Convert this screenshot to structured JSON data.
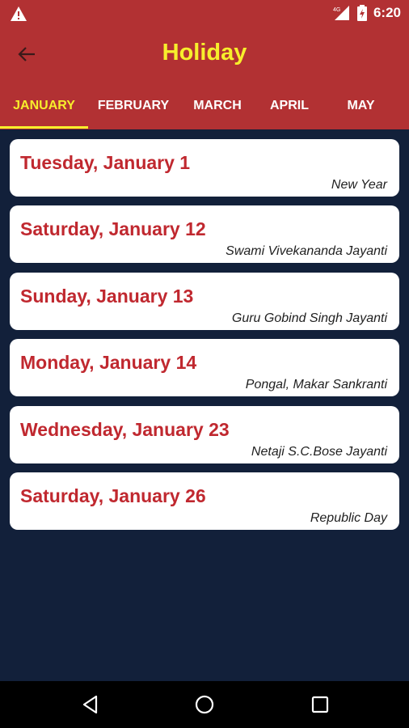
{
  "status_bar": {
    "network": "4G",
    "battery_icon": "battery-charging-icon",
    "time": "6:20"
  },
  "app_bar": {
    "title": "Holiday",
    "back_icon": "back-arrow-icon"
  },
  "tabs": [
    {
      "label": "JANUARY",
      "active": true
    },
    {
      "label": "FEBRUARY",
      "active": false
    },
    {
      "label": "MARCH",
      "active": false
    },
    {
      "label": "APRIL",
      "active": false
    },
    {
      "label": "MAY",
      "active": false
    }
  ],
  "holidays": [
    {
      "date": "Tuesday, January 1",
      "name": "New Year"
    },
    {
      "date": "Saturday, January 12",
      "name": "Swami Vivekananda Jayanti"
    },
    {
      "date": "Sunday, January 13",
      "name": "Guru Gobind Singh Jayanti"
    },
    {
      "date": "Monday, January 14",
      "name": "Pongal, Makar Sankranti"
    },
    {
      "date": "Wednesday, January 23",
      "name": "Netaji S.C.Bose Jayanti"
    },
    {
      "date": "Saturday, January 26",
      "name": "Republic Day"
    }
  ],
  "colors": {
    "primary": "#b23133",
    "accent": "#f7ee2c",
    "background": "#12203a",
    "date_text": "#c0282f"
  }
}
